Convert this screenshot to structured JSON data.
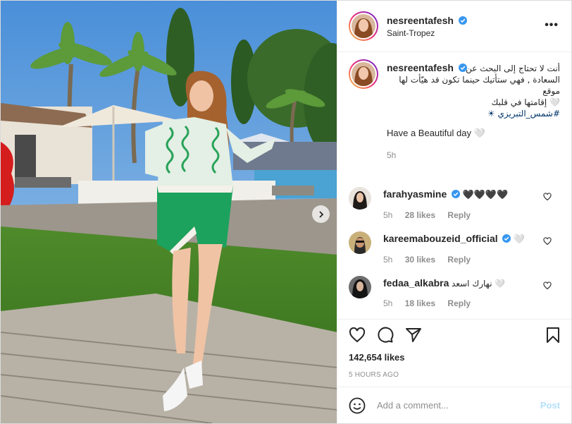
{
  "post": {
    "username": "nesreentafesh",
    "location": "Saint-Tropez",
    "more_label": "•••",
    "caption": {
      "lines_ar": [
        "أنت لا تحتاج إلى البحث عن",
        "السعادة , فهي ستأتيك حينما تكون قد هيّأت لها موقع",
        "🤍 إقامتها في قلبك"
      ],
      "hashtag": "#شمس_التبريزي ☀",
      "english": "Have a Beautiful day 🤍",
      "time": "5h"
    },
    "comments": [
      {
        "username": "farahyasmine",
        "verified": true,
        "text": "🖤🖤🖤🖤",
        "time": "5h",
        "likes": "28 likes",
        "reply": "Reply"
      },
      {
        "username": "kareemabouzeid_official",
        "verified": true,
        "text": "🤍",
        "time": "5h",
        "likes": "30 likes",
        "reply": "Reply"
      },
      {
        "username": "fedaa_alkabra",
        "verified": false,
        "text": "نهارك اسعد 🤍",
        "time": "5h",
        "likes": "18 likes",
        "reply": "Reply"
      }
    ],
    "likes_count": "142,654 likes",
    "posted_ago": "5 HOURS AGO",
    "add_comment": {
      "placeholder": "Add a comment...",
      "post_label": "Post"
    },
    "icons": {
      "like": "heart-icon",
      "comment": "comment-icon",
      "share": "paper-plane-icon",
      "save": "bookmark-icon",
      "emoji": "emoji-icon",
      "next": "chevron-right-icon",
      "verified": "verified-badge-icon"
    },
    "colors": {
      "verified": "#3897f0",
      "link": "#00376b",
      "muted": "#8e8e8e",
      "post_disabled": "#b2dffc"
    }
  }
}
